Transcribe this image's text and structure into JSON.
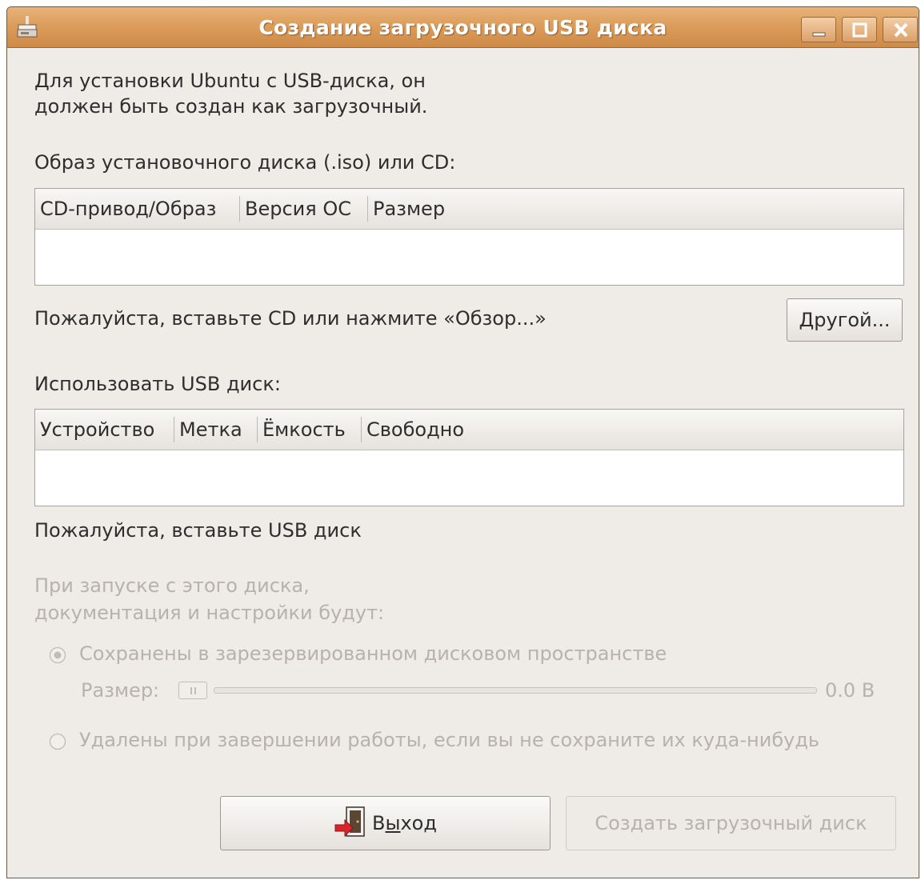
{
  "window": {
    "title": "Создание загрузочного USB диска",
    "controls": {
      "minimize": "minimize-icon",
      "maximize": "maximize-icon",
      "close": "close-icon"
    }
  },
  "intro": {
    "line1": "Для установки Ubuntu с USB-диска, он",
    "line2": "должен быть создан как загрузочный."
  },
  "source": {
    "label": "Образ установочного диска (.iso) или CD:",
    "columns": [
      "CD-привод/Образ",
      "Версия ОС",
      "Размер"
    ],
    "rows": [],
    "status": "Пожалуйста, вставьте CD или нажмите «Обзор...»",
    "other_button": "Другой..."
  },
  "usb": {
    "label": "Использовать USB диск:",
    "columns": [
      "Устройство",
      "Метка",
      "Ёмкость",
      "Свободно"
    ],
    "rows": [],
    "status": "Пожалуйста, вставьте USB диск"
  },
  "persistence": {
    "label_line1": "При запуске с этого диска,",
    "label_line2": "документация и настройки будут:",
    "option_saved": "Сохранены в зарезервированном дисковом пространстве",
    "option_saved_checked": true,
    "size_label": "Размер:",
    "size_value": "0.0 B",
    "size_fraction": 0,
    "option_discarded": "Удалены при завершении работы, если вы не сохраните их куда-нибудь",
    "enabled": false
  },
  "buttons": {
    "quit_pre": "В",
    "quit_mnemonic": "ы",
    "quit_post": "ход",
    "make_startup": "Создать загрузочный диск",
    "make_startup_enabled": false
  },
  "colors": {
    "titlebar": "#dc9d5b",
    "window_bg": "#efebe7",
    "disabled_text": "#b7b2ab",
    "quit_icon_arrow": "#d9262a"
  }
}
